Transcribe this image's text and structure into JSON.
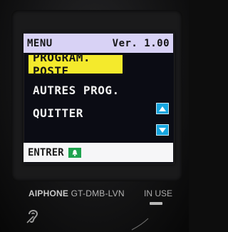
{
  "device": {
    "brand": "AIPHONE",
    "model": "GT-DMB-LVN",
    "status_label": "IN USE"
  },
  "screen": {
    "header": {
      "title": "MENU",
      "version": "Ver. 1.00"
    },
    "menu_items": [
      {
        "label": "PROGRAM. POSTE",
        "selected": true
      },
      {
        "label": "AUTRES PROG.",
        "selected": false
      },
      {
        "label": "QUITTER",
        "selected": false
      }
    ],
    "footer": {
      "enter_label": "ENTRER"
    },
    "icons": {
      "up": "arrow-up-icon",
      "down": "arrow-down-icon",
      "enter": "bell-icon"
    }
  },
  "colors": {
    "header_bg": "#d8d2f5",
    "selected_bg": "#f4ea2c",
    "arrow_bg": "#16a6e0",
    "enter_icon_bg": "#1fa34f"
  }
}
